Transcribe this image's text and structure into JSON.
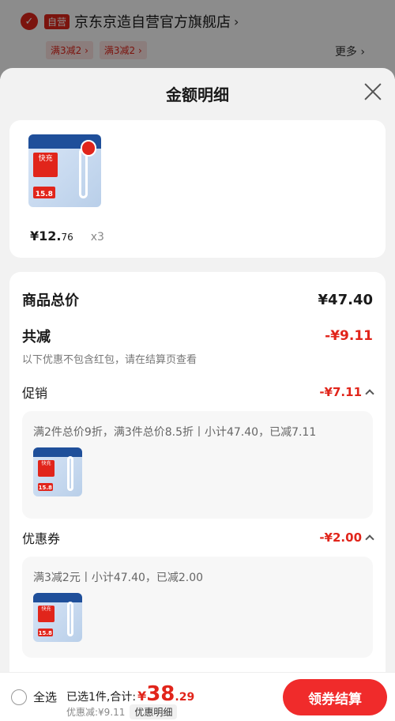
{
  "store": {
    "self_tag": "自营",
    "name": "京东京造自营官方旗舰店",
    "arrow": "›",
    "promos": [
      "满3减2 ›",
      "满3减2 ›"
    ],
    "more": "更多 ›"
  },
  "sheet": {
    "title": "金额明细"
  },
  "product": {
    "thumb_label": "快充",
    "thumb_price": "15.8",
    "price_main": "¥12.",
    "price_cents": "76",
    "qty": "x3"
  },
  "detail": {
    "total_label": "商品总价",
    "total_value": "¥47.40",
    "reduce_label": "共减",
    "reduce_value": "-¥9.11",
    "note": "以下优惠不包含红包，请在结算页查看",
    "promo_label": "促销",
    "promo_value": "-¥7.11",
    "promo_desc": "满2件总价9折，满3件总价8.5折丨小计47.40，已减7.11",
    "coupon_label": "优惠券",
    "coupon_value": "-¥2.00",
    "coupon_desc": "满3减2元丨小计47.40，已减2.00"
  },
  "bottom": {
    "select_all": "全选",
    "summary": "已选1件,合计:",
    "yen": "¥",
    "total_int": "38",
    "total_cents": ".29",
    "discount": "优惠减:¥9.11",
    "detail_chip": "优惠明细",
    "checkout": "领券结算"
  },
  "colors": {
    "accent": "#e1251b",
    "button": "#f02b2b"
  }
}
